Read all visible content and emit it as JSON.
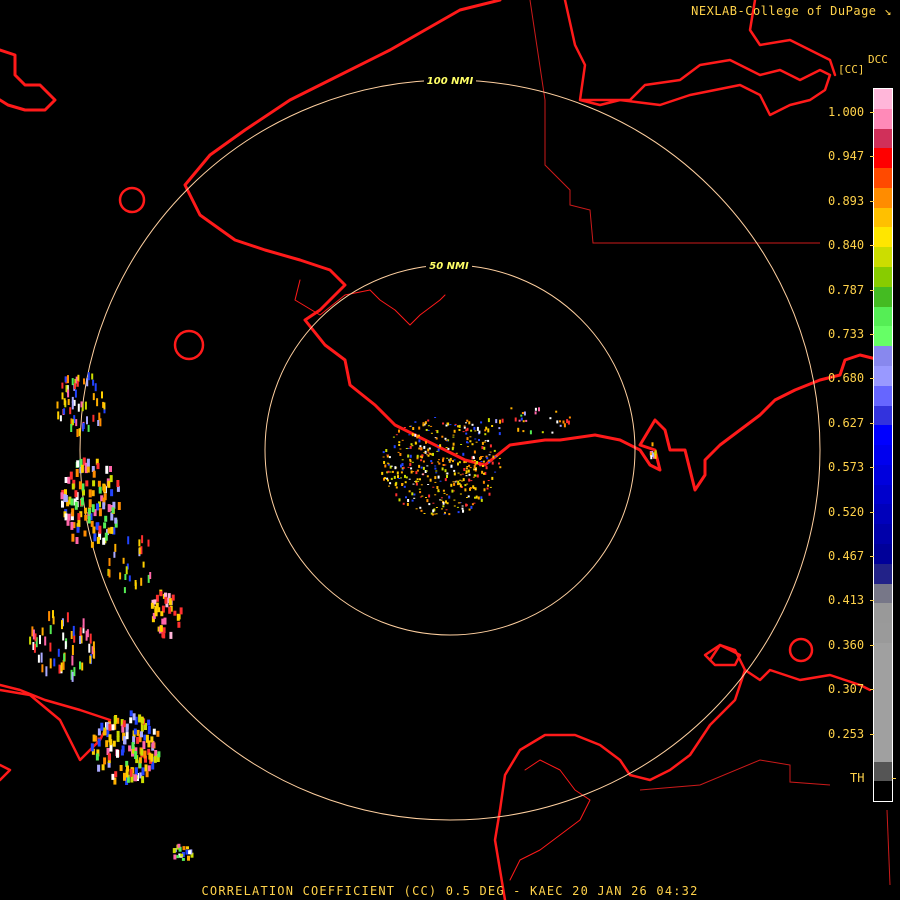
{
  "header": {
    "credit": "NEXLAB-College of DuPage",
    "credit_icon": "arrow-icon"
  },
  "legend": {
    "product_code": "DCC",
    "unit": "[CC]",
    "ticks": [
      "1.000",
      "0.947",
      "0.893",
      "0.840",
      "0.787",
      "0.733",
      "0.680",
      "0.627",
      "0.573",
      "0.520",
      "0.467",
      "0.413",
      "0.360",
      "0.307",
      "0.253",
      "TH"
    ],
    "colors": [
      "#ffb6d9",
      "#ff8ab8",
      "#d0305a",
      "#ff0000",
      "#ff4a00",
      "#ff8c00",
      "#ffc000",
      "#ffe600",
      "#ccdd00",
      "#88cc00",
      "#44bb22",
      "#55ee55",
      "#66ff66",
      "#8888ee",
      "#9999ff",
      "#6666ff",
      "#3333dd",
      "#0000ff",
      "#0000ee",
      "#0000dd",
      "#0000cc",
      "#0000bb",
      "#0000aa",
      "#000099",
      "#222288",
      "#777788",
      "#999999",
      "#9a9a9a",
      "#a0a0a0",
      "#a0a0a0",
      "#a0a0a0",
      "#a0a0a0",
      "#a0a0a0",
      "#a0a0a0",
      "#555555",
      "#000000"
    ]
  },
  "map": {
    "range_rings": [
      {
        "label": "50 NMI",
        "radius_nmi": 50
      },
      {
        "label": "100 NMI",
        "radius_nmi": 100
      }
    ],
    "colors": {
      "coastline": "#ff1a1a",
      "border": "#cc1a1a",
      "ring": "#ffd0a0",
      "ring_label": "#ffff66"
    }
  },
  "footer": {
    "title": "CORRELATION COEFFICIENT (CC) 0.5 DEG - KAEC 20 JAN 26 04:32"
  }
}
